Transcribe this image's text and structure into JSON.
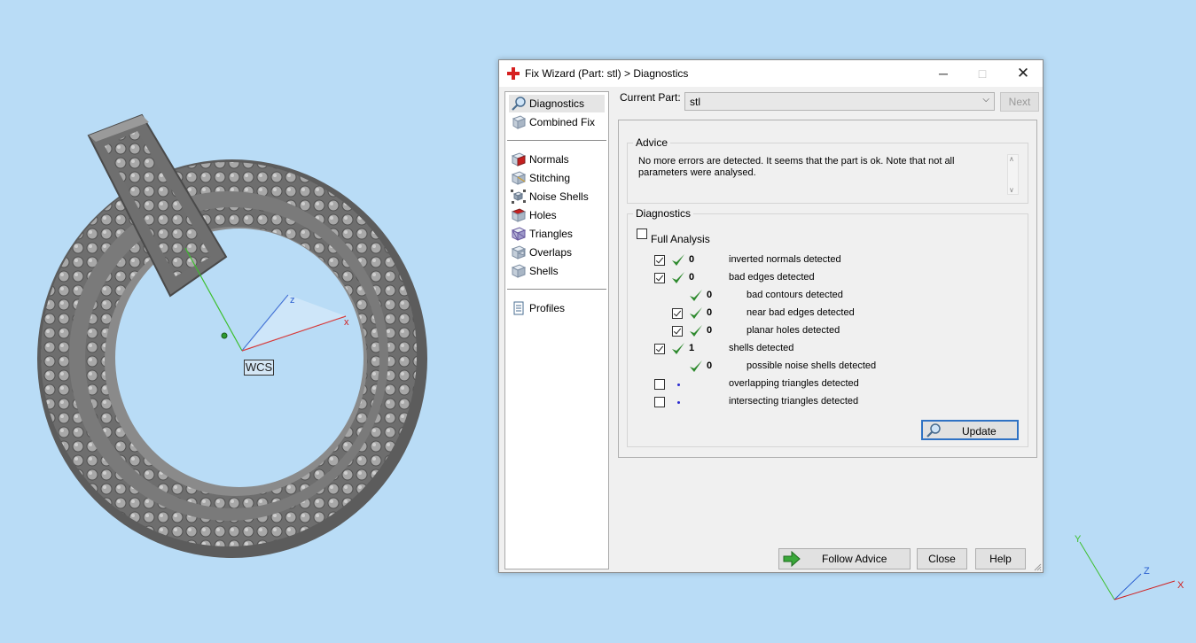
{
  "window": {
    "title": "Fix Wizard (Part: stl) > Diagnostics",
    "controls": [
      "minimize",
      "maximize",
      "close"
    ]
  },
  "nav": {
    "items": [
      {
        "label": "Diagnostics",
        "icon": "magnifier-icon",
        "selected": true
      },
      {
        "label": "Combined Fix",
        "icon": "cube-icon"
      },
      {
        "label": "Normals",
        "icon": "normals-cube-icon"
      },
      {
        "label": "Stitching",
        "icon": "stitching-cube-icon"
      },
      {
        "label": "Noise Shells",
        "icon": "noise-shells-icon"
      },
      {
        "label": "Holes",
        "icon": "holes-cube-icon"
      },
      {
        "label": "Triangles",
        "icon": "triangles-cube-icon"
      },
      {
        "label": "Overlaps",
        "icon": "overlaps-cube-icon"
      },
      {
        "label": "Shells",
        "icon": "shells-cube-icon"
      },
      {
        "label": "Profiles",
        "icon": "document-icon"
      }
    ]
  },
  "header": {
    "current_part_label": "Current Part:",
    "current_part_value": "stl",
    "next_label": "Next"
  },
  "advice": {
    "title": "Advice",
    "text": "No more errors are detected. It seems that the part is ok. Note that not all parameters were analysed."
  },
  "diagnostics": {
    "title": "Diagnostics",
    "full_analysis_label": "Full Analysis",
    "full_analysis_checked": false,
    "rows": [
      {
        "label": "inverted normals detected",
        "count": "0",
        "checked": true,
        "status": "ok"
      },
      {
        "label": "bad edges detected",
        "count": "0",
        "checked": true,
        "status": "ok"
      },
      {
        "label": "bad contours detected",
        "count": "0",
        "checked": null,
        "status": "ok"
      },
      {
        "label": "near bad edges detected",
        "count": "0",
        "checked": true,
        "status": "ok"
      },
      {
        "label": "planar holes detected",
        "count": "0",
        "checked": true,
        "status": "ok"
      },
      {
        "label": "shells detected",
        "count": "1",
        "checked": true,
        "status": "ok"
      },
      {
        "label": "possible noise shells detected",
        "count": "0",
        "checked": null,
        "status": "ok"
      },
      {
        "label": "overlapping triangles detected",
        "count": "",
        "checked": false,
        "status": "pending"
      },
      {
        "label": "intersecting triangles detected",
        "count": "",
        "checked": false,
        "status": "pending"
      }
    ],
    "update_label": "Update"
  },
  "footer": {
    "follow_advice_label": "Follow Advice",
    "close_label": "Close",
    "help_label": "Help"
  },
  "viewport": {
    "wcs_label": "WCS",
    "axis_x": "x",
    "axis_z": "z",
    "triad_x": "X",
    "triad_y": "Y",
    "triad_z": "Z",
    "background_color": "#b9dcf6"
  }
}
